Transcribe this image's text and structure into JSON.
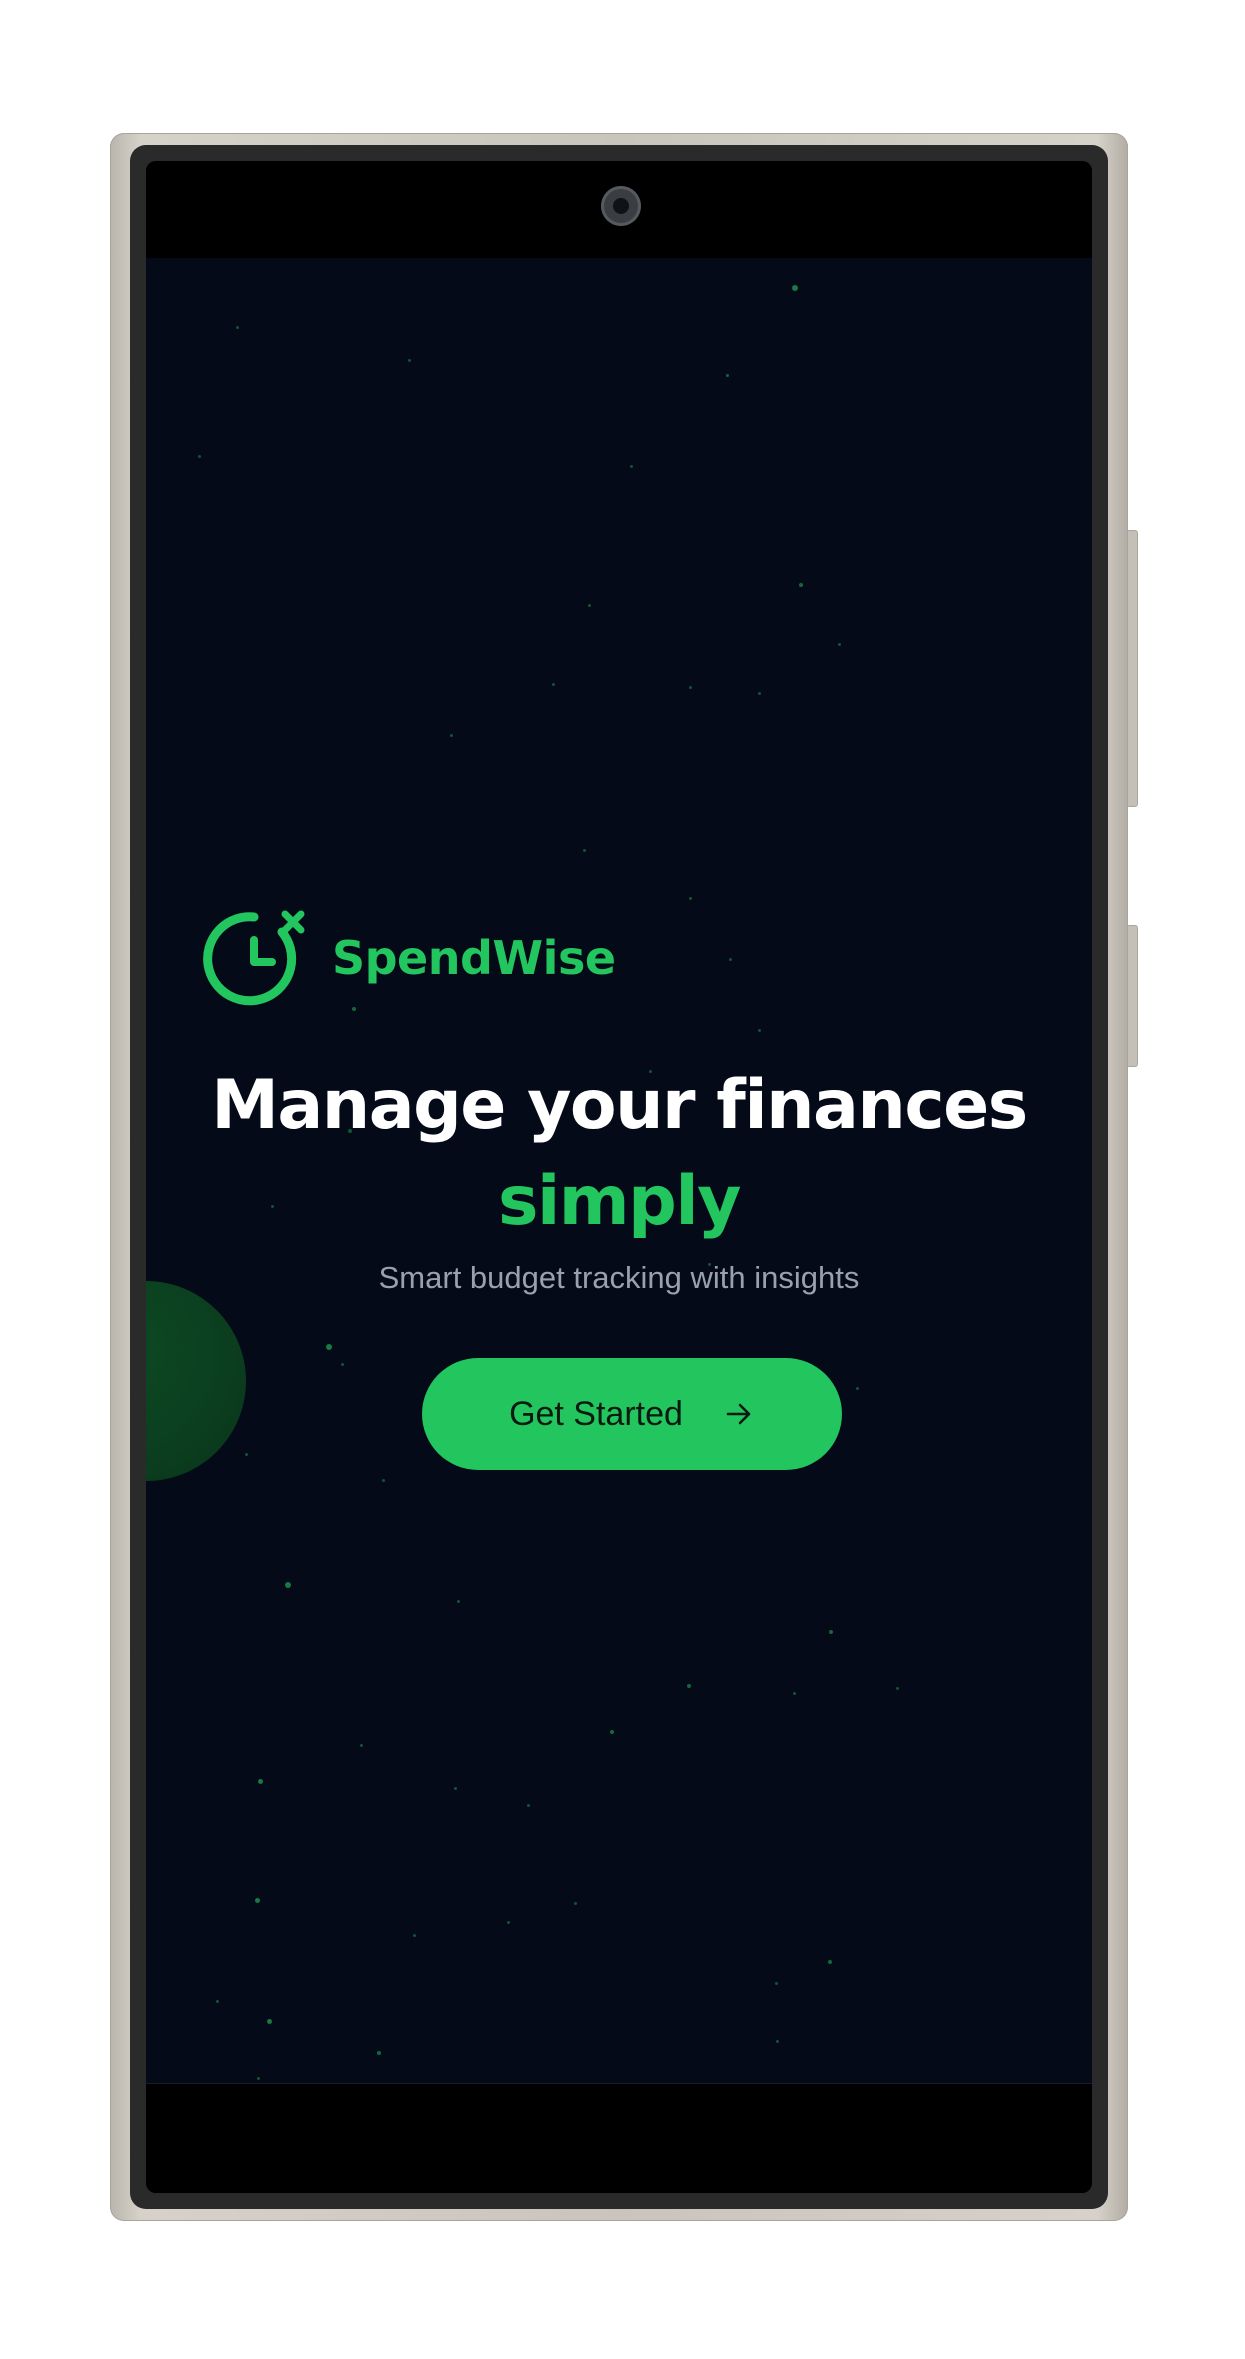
{
  "app": {
    "name": "SpendWise",
    "icon": "clock-x-icon"
  },
  "hero": {
    "headline": "Manage your finances",
    "headline_accent": "simply",
    "subtitle": "Smart budget tracking with insights"
  },
  "cta": {
    "label": "Get Started",
    "icon": "arrow-right-icon"
  },
  "colors": {
    "background": "#050a19",
    "accent": "#22c55e",
    "headline": "#ffffff",
    "subtitle": "#9aa0ad",
    "button_text": "#0b1a10"
  }
}
